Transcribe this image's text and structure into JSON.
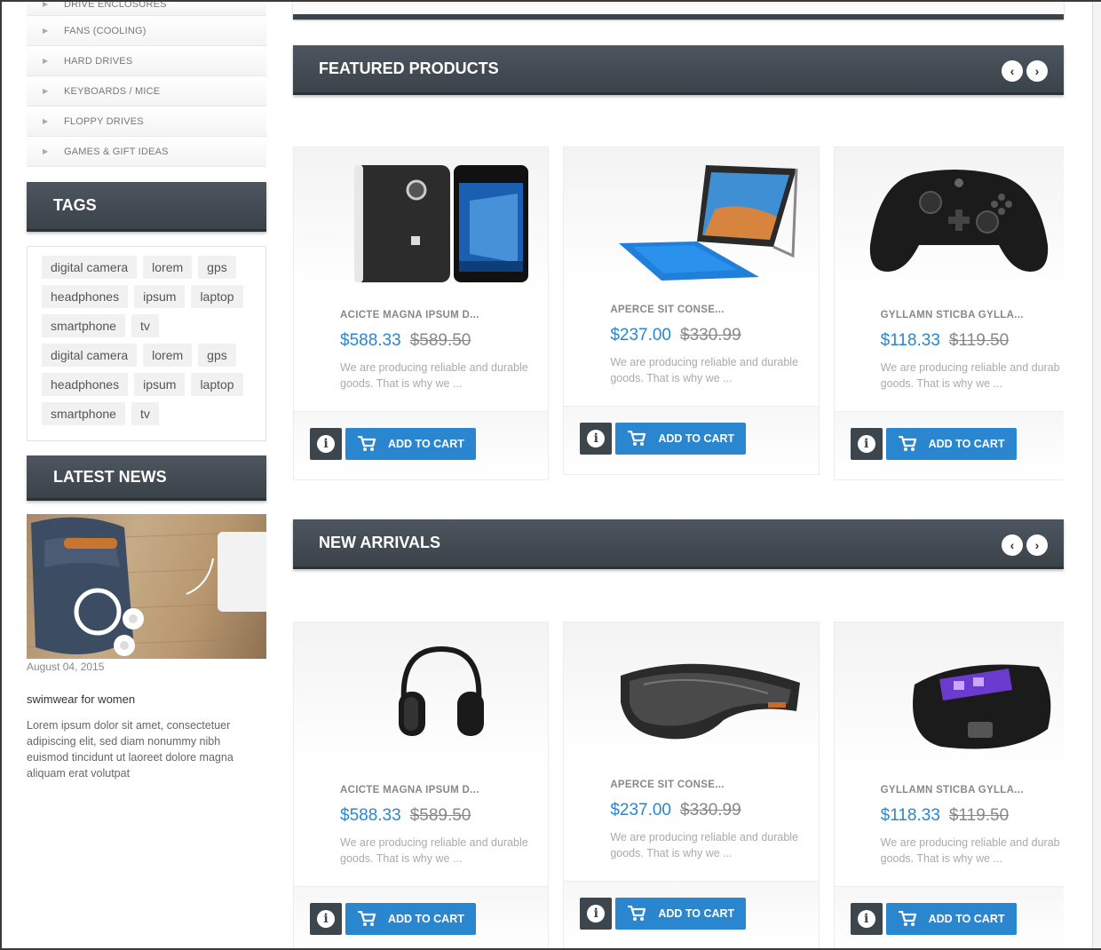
{
  "sidebar": {
    "categories": [
      {
        "label": "DRIVE ENCLOSURES"
      },
      {
        "label": "FANS (COOLING)"
      },
      {
        "label": "HARD DRIVES"
      },
      {
        "label": "KEYBOARDS / MICE"
      },
      {
        "label": "FLOPPY DRIVES"
      },
      {
        "label": "GAMES & GIFT IDEAS"
      }
    ],
    "tags_heading": "TAGS",
    "tags": [
      [
        "digital camera",
        "lorem",
        "gps"
      ],
      [
        "headphones",
        "ipsum",
        "laptop"
      ],
      [
        "smartphone",
        "tv"
      ],
      [
        "digital camera",
        "lorem",
        "gps"
      ],
      [
        "headphones",
        "ipsum",
        "laptop"
      ],
      [
        "smartphone",
        "tv"
      ]
    ],
    "news_heading": "LATEST NEWS",
    "news": {
      "date": "August 04, 2015",
      "title": "swimwear for women",
      "text": "Lorem ipsum dolor sit amet, consectetuer adipiscing elit, sed diam nonummy nibh euismod tincidunt ut laoreet dolore magna aliquam erat volutpat"
    }
  },
  "sections": [
    {
      "title": "FEATURED PRODUCTS",
      "products": [
        {
          "name": "ACICTE MAGNA IPSUM D...",
          "price": "$588.33",
          "old_price": "$589.50",
          "desc1": "We are producing reliable and durable",
          "desc2": "goods. That is why we ...",
          "image": "phone-image",
          "cart_label": "ADD TO CART"
        },
        {
          "name": "APERCE SIT CONSE...",
          "price": "$237.00",
          "old_price": "$330.99",
          "desc1": "We are producing reliable and durable",
          "desc2": "goods. That is why we ...",
          "image": "tablet-image",
          "cart_label": "ADD TO CART"
        },
        {
          "name": "GYLLAMN STICBA GYLLA...",
          "price": "$118.33",
          "old_price": "$119.50",
          "desc1": "We are producing reliable and durab",
          "desc2": "goods. That is why we ...",
          "image": "gamepad-image",
          "cart_label": "ADD TO CART"
        }
      ]
    },
    {
      "title": "NEW ARRIVALS",
      "products": [
        {
          "name": "ACICTE MAGNA IPSUM D...",
          "price": "$588.33",
          "old_price": "$589.50",
          "desc1": "We are producing reliable and durable",
          "desc2": "goods. That is why we ...",
          "image": "headphones-image",
          "cart_label": "ADD TO CART"
        },
        {
          "name": "APERCE SIT CONSE...",
          "price": "$237.00",
          "old_price": "$330.99",
          "desc1": "We are producing reliable and durable",
          "desc2": "goods. That is why we ...",
          "image": "vr-headset-image",
          "cart_label": "ADD TO CART"
        },
        {
          "name": "GYLLAMN STICBA GYLLA...",
          "price": "$118.33",
          "old_price": "$119.50",
          "desc1": "We are producing reliable and durab",
          "desc2": "goods. That is why we ...",
          "image": "smart-band-image",
          "cart_label": "ADD TO CART"
        }
      ]
    }
  ],
  "colors": {
    "accent": "#2a86cf",
    "header": "#3f474f"
  }
}
